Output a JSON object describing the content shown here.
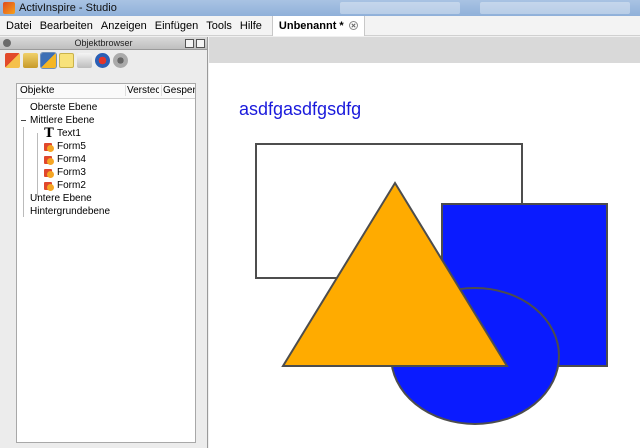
{
  "window": {
    "title": "ActivInspire - Studio"
  },
  "menu": {
    "items": [
      {
        "name": "menu-datei",
        "label": "Datei"
      },
      {
        "name": "menu-bearbeiten",
        "label": "Bearbeiten"
      },
      {
        "name": "menu-anzeigen",
        "label": "Anzeigen"
      },
      {
        "name": "menu-einfuegen",
        "label": "Einfügen"
      },
      {
        "name": "menu-tools",
        "label": "Tools"
      },
      {
        "name": "menu-hilfe",
        "label": "Hilfe"
      }
    ],
    "document_tab": "Unbenannt *"
  },
  "object_browser": {
    "title": "Objektbrowser",
    "columns": {
      "objects": "Objekte",
      "hidden": "Versteckt",
      "locked": "Gesperrt"
    },
    "tree": {
      "top_layer": "Oberste Ebene",
      "middle_layer": "Mittlere Ebene",
      "children": [
        {
          "type": "text",
          "label": "Text1"
        },
        {
          "type": "shape",
          "label": "Form5"
        },
        {
          "type": "shape",
          "label": "Form4"
        },
        {
          "type": "shape",
          "label": "Form3"
        },
        {
          "type": "shape",
          "label": "Form2"
        }
      ],
      "bottom_layer": "Untere Ebene",
      "background_layer": "Hintergrundebene"
    }
  },
  "canvas": {
    "text": "asdfgasdfgsdfg",
    "colors": {
      "text": "#1a1adc",
      "triangle": "#ffab00",
      "square": "#0a1bff",
      "circle": "#0a1bff",
      "outline": "#4d4d4d"
    }
  }
}
